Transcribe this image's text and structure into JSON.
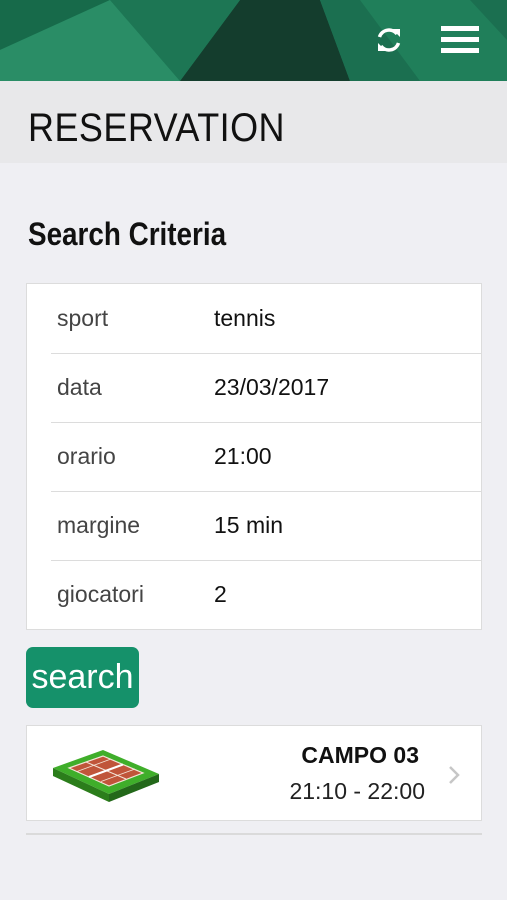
{
  "page": {
    "title": "RESERVATION"
  },
  "search_criteria": {
    "title": "Search Criteria",
    "rows": [
      {
        "label": "sport",
        "value": "tennis"
      },
      {
        "label": "data",
        "value": "23/03/2017"
      },
      {
        "label": "orario",
        "value": "21:00"
      },
      {
        "label": "margine",
        "value": "15 min"
      },
      {
        "label": "giocatori",
        "value": "2"
      }
    ]
  },
  "search_button": {
    "label": "search"
  },
  "results": [
    {
      "name": "CAMPO 03",
      "time": "21:10 - 22:00",
      "icon": "tennis-court-icon"
    }
  ],
  "icons": {
    "refresh": "refresh-icon",
    "menu": "hamburger-menu-icon",
    "chevron": "chevron-right-icon"
  },
  "colors": {
    "header_green": "#1e7d59",
    "button_green": "#15916a"
  }
}
